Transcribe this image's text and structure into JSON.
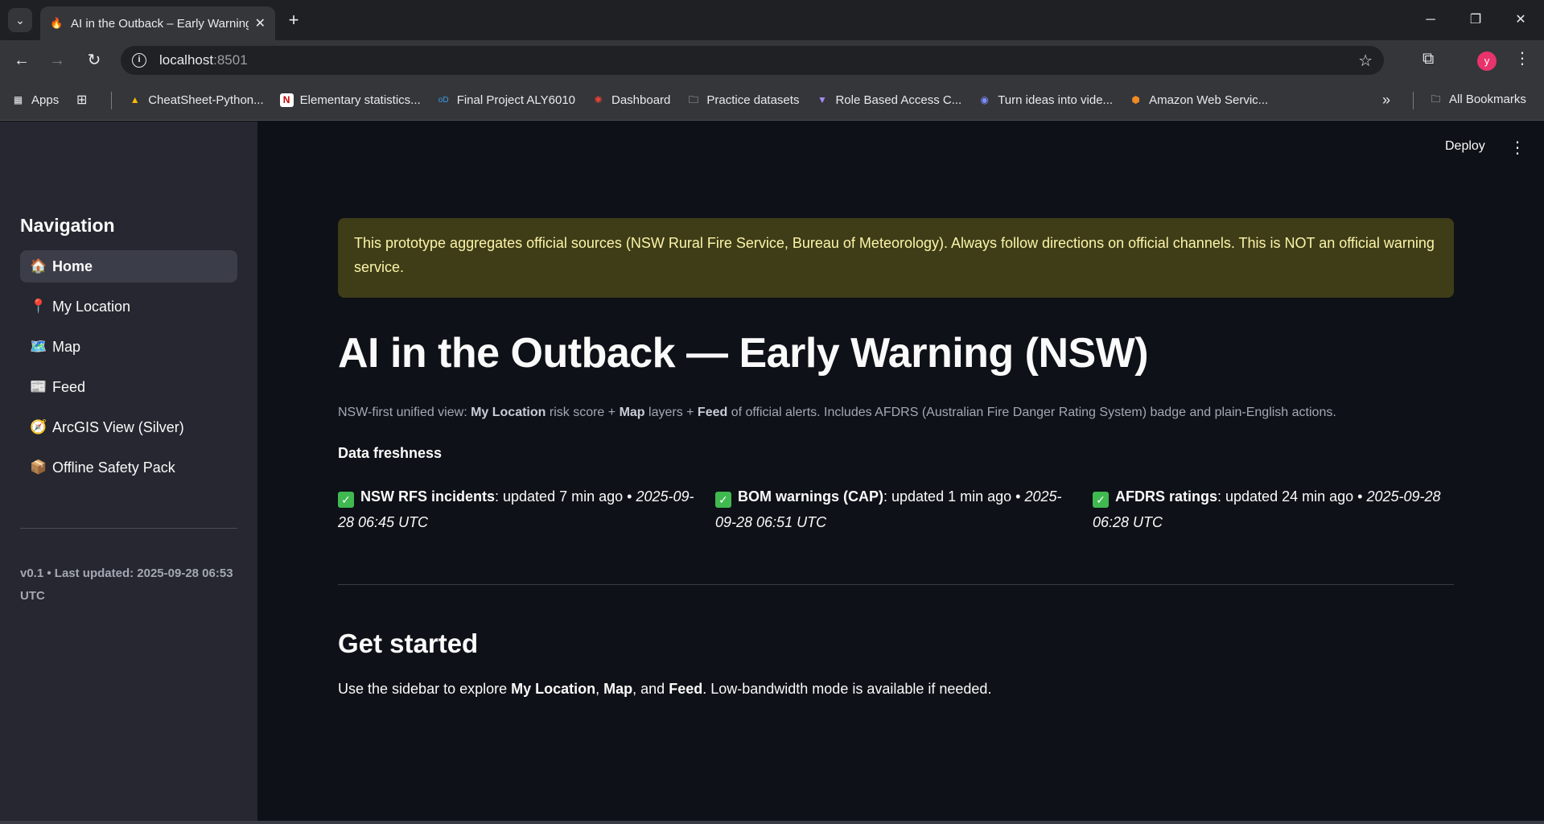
{
  "browser": {
    "tab_title": "AI in the Outback – Early Warning",
    "url_host": "localhost",
    "url_port": ":8501",
    "bookmarks": [
      {
        "label": "Apps",
        "icon": "apps-grid-icon"
      },
      {
        "label": "CheatSheet-Python...",
        "icon": "drive-icon"
      },
      {
        "label": "Elementary statistics...",
        "icon": "notion-icon"
      },
      {
        "label": "Final Project ALY6010",
        "icon": "project-icon"
      },
      {
        "label": "Dashboard",
        "icon": "dashboard-icon"
      },
      {
        "label": "Practice datasets",
        "icon": "folder-icon"
      },
      {
        "label": "Role Based Access C...",
        "icon": "vite-icon"
      },
      {
        "label": "Turn ideas into vide...",
        "icon": "video-icon"
      },
      {
        "label": "Amazon Web Servic...",
        "icon": "aws-icon"
      }
    ],
    "all_bookmarks": "All Bookmarks",
    "avatar_letter": "y"
  },
  "sidebar": {
    "heading": "Navigation",
    "items": [
      {
        "emoji": "🏠",
        "label": "Home"
      },
      {
        "emoji": "📍",
        "label": "My Location"
      },
      {
        "emoji": "🗺️",
        "label": "Map"
      },
      {
        "emoji": "📰",
        "label": "Feed"
      },
      {
        "emoji": "🧭",
        "label": "ArcGIS View (Silver)"
      },
      {
        "emoji": "📦",
        "label": "Offline Safety Pack"
      }
    ],
    "footer": "v0.1 • Last updated: 2025-09-28 06:53 UTC"
  },
  "header": {
    "deploy": "Deploy"
  },
  "main": {
    "banner": "This prototype aggregates official sources (NSW Rural Fire Service, Bureau of Meteorology). Always follow directions on official channels. This is NOT an official warning service.",
    "title": "AI in the Outback — Early Warning (NSW)",
    "subtitle": {
      "p1": "NSW-first unified view: ",
      "b1": "My Location",
      "p2": " risk score + ",
      "b2": "Map",
      "p3": " layers + ",
      "b3": "Feed",
      "p4": " of official alerts. Includes AFDRS (Australian Fire Danger Rating System) badge and plain-English actions."
    },
    "freshness_heading": "Data freshness",
    "freshness": [
      {
        "name": "NSW RFS incidents",
        "status": ": updated 7 min ago • ",
        "time": "2025-09-28 06:45 UTC"
      },
      {
        "name": "BOM warnings (CAP)",
        "status": ": updated 1 min ago • ",
        "time": "2025-09-28 06:51 UTC"
      },
      {
        "name": "AFDRS ratings",
        "status": ": updated 24 min ago • ",
        "time": "2025-09-28 06:28 UTC"
      }
    ],
    "get_started_heading": "Get started",
    "get_started": {
      "p1": "Use the sidebar to explore ",
      "b1": "My Location",
      "p2": ", ",
      "b2": "Map",
      "p3": ", and ",
      "b3": "Feed",
      "p4": ". Low-bandwidth mode is available if needed."
    }
  }
}
